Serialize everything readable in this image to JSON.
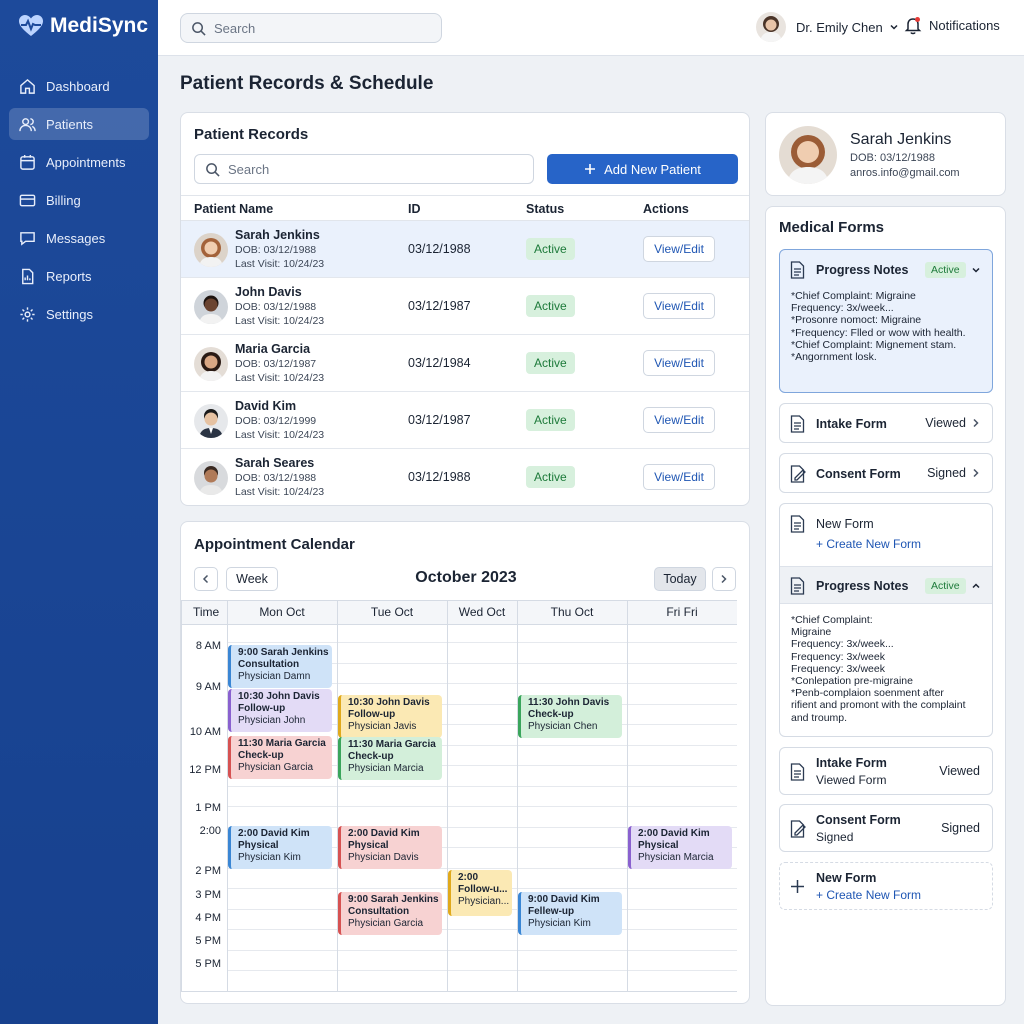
{
  "app": {
    "name": "MediSync"
  },
  "sidebar": {
    "items": [
      {
        "label": "Dashboard",
        "icon": "home-icon"
      },
      {
        "label": "Patients",
        "icon": "users-icon",
        "active": true
      },
      {
        "label": "Appointments",
        "icon": "calendar-icon"
      },
      {
        "label": "Billing",
        "icon": "card-icon"
      },
      {
        "label": "Messages",
        "icon": "chat-icon"
      },
      {
        "label": "Reports",
        "icon": "report-icon"
      },
      {
        "label": "Settings",
        "icon": "gear-icon"
      }
    ]
  },
  "topbar": {
    "search_placeholder": "Search",
    "user_name": "Dr. Emily Chen",
    "notifications_label": "Notifications"
  },
  "page": {
    "title": "Patient Records & Schedule"
  },
  "records": {
    "title": "Patient Records",
    "search_placeholder": "Search",
    "add_button": "Add New Patient",
    "columns": [
      "Patient Name",
      "ID",
      "Status",
      "Actions"
    ],
    "rows": [
      {
        "name": "Sarah Jenkins",
        "dob": "DOB: 03/12/1988",
        "visit": "Last Visit: 10/24/23",
        "id": "03/12/1988",
        "status": "Active",
        "action": "View/Edit",
        "selected": true
      },
      {
        "name": "John Davis",
        "dob": "DOB: 03/12/1988",
        "visit": "Last Visit: 10/24/23",
        "id": "03/12/1987",
        "status": "Active",
        "action": "View/Edit"
      },
      {
        "name": "Maria Garcia",
        "dob": "DOB: 03/12/1987",
        "visit": "Last Visit: 10/24/23",
        "id": "03/12/1984",
        "status": "Active",
        "action": "View/Edit"
      },
      {
        "name": "David Kim",
        "dob": "DOB: 03/12/1999",
        "visit": "Last Visit: 10/24/23",
        "id": "03/12/1987",
        "status": "Active",
        "action": "View/Edit"
      },
      {
        "name": "Sarah Seares",
        "dob": "DOB: 03/12/1988",
        "visit": "Last Visit: 10/24/23",
        "id": "03/12/1988",
        "status": "Active",
        "action": "View/Edit"
      }
    ]
  },
  "profile": {
    "name": "Sarah Jenkins",
    "dob": "DOB: 03/12/1988",
    "email": "anros.info@gmail.com"
  },
  "forms": {
    "title": "Medical Forms",
    "progress1": {
      "title": "Progress Notes",
      "badge": "Active",
      "notes": [
        "*Chief Complaint: Migraine",
        "Frequency: 3x/week...",
        "*Prosonre nomoct: Migraine",
        "*Frequency: Flled or wow with health.",
        "*Chief Complaint: Mignement stam.",
        "*Angornment losk."
      ]
    },
    "intake1": {
      "title": "Intake Form",
      "status": "Viewed"
    },
    "consent1": {
      "title": "Consent Form",
      "status": "Signed"
    },
    "new1": {
      "title": "New Form",
      "link": "+ Create New Form"
    },
    "progress2": {
      "title": "Progress Notes",
      "badge": "Active",
      "notes": [
        "*Chief Complaint:",
        "Migraine",
        "Frequency: 3x/week...",
        "Frequency: 3x/week",
        "Frequency: 3x/week",
        "*Conlepation pre-migraine",
        "*Penb-complaion soenment after",
        "rifient and promont with the complaint",
        "and troump."
      ]
    },
    "intake2": {
      "title": "Intake Form",
      "sub": "Viewed Form",
      "status": "Viewed"
    },
    "consent2": {
      "title": "Consent Form",
      "sub": "Signed",
      "status": "Signed"
    },
    "new2": {
      "title": "New Form",
      "link": "+ Create New Form"
    }
  },
  "calendar": {
    "title": "Appointment Calendar",
    "week_button": "Week",
    "month": "October 2023",
    "today_button": "Today",
    "time_header": "Time",
    "days": [
      "Mon Oct",
      "Tue Oct",
      "Wed Oct",
      "Thu Oct",
      "Fri Fri"
    ],
    "time_labels": [
      "8 AM",
      "9 AM",
      "10 AM",
      "12 PM",
      "1 PM",
      "2:00",
      "2 PM",
      "3 PM",
      "4 PM",
      "5 PM",
      "5 PM"
    ],
    "events": [
      {
        "day": 0,
        "slot": 0,
        "l1": "9:00 Sarah Jenkins",
        "l2": "Consultation",
        "l3": "Physician Damn",
        "color": "blue"
      },
      {
        "day": 0,
        "slot": 1,
        "l1": "10:30 John Davis",
        "l2": "Follow-up",
        "l3": "Physician John",
        "color": "purple"
      },
      {
        "day": 0,
        "slot": 2,
        "l1": "11:30 Maria Garcia",
        "l2": "Check-up",
        "l3": "Physician Garcia",
        "color": "red"
      },
      {
        "day": 0,
        "slot": 4,
        "l1": "2:00 David Kim",
        "l2": "Physical",
        "l3": "Physician Kim",
        "color": "blue"
      },
      {
        "day": 1,
        "slot": 1,
        "l1": "10:30 John Davis",
        "l2": "Follow-up",
        "l3": "Physician Javis",
        "color": "yellow"
      },
      {
        "day": 1,
        "slot": 2,
        "l1": "11:30 Maria Garcia",
        "l2": "Check-up",
        "l3": "Physician Marcia",
        "color": "green"
      },
      {
        "day": 1,
        "slot": 4,
        "l1": "2:00 David Kim",
        "l2": "Physical",
        "l3": "Physician Davis",
        "color": "red"
      },
      {
        "day": 1,
        "slot": 6,
        "l1": "9:00 Sarah Jenkins",
        "l2": "Consultation",
        "l3": "Physician Garcia",
        "color": "red"
      },
      {
        "day": 2,
        "slot": 5,
        "l1": "2:00",
        "l2": "Follow-u...",
        "l3": "Physician...",
        "color": "yellow"
      },
      {
        "day": 3,
        "slot": 1,
        "l1": "11:30 John Davis",
        "l2": "Check-up",
        "l3": "Physician Chen",
        "color": "green"
      },
      {
        "day": 3,
        "slot": 6,
        "l1": "9:00 David Kim",
        "l2": "Fellew-up",
        "l3": "Physician Kim",
        "color": "blue"
      },
      {
        "day": 4,
        "slot": 4,
        "l1": "2:00 David Kim",
        "l2": "Physical",
        "l3": "Physician Marcia",
        "color": "purple"
      }
    ]
  },
  "colors": {
    "sidebar": "#1d4a9b",
    "accent": "#2764c8",
    "active_badge_bg": "#d7f0dd",
    "active_badge_text": "#1d7a3a"
  }
}
